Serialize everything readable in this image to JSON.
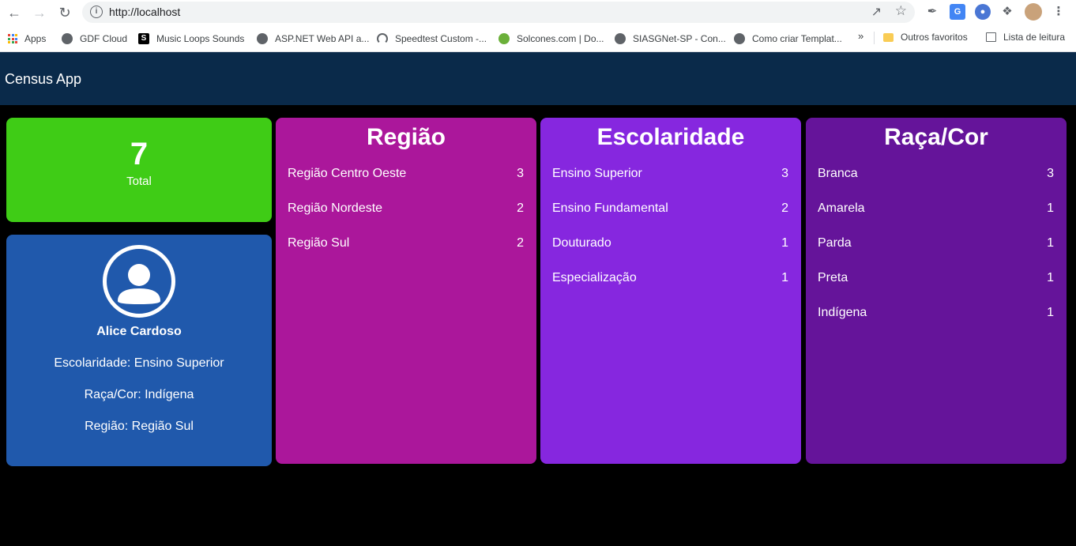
{
  "browser": {
    "url": "http://localhost",
    "bookmarks": [
      {
        "label": "Apps",
        "icon": "apps-grid-icon"
      },
      {
        "label": "GDF Cloud",
        "icon": "globe-icon"
      },
      {
        "label": "Music Loops Sounds",
        "icon": "s-logo-icon"
      },
      {
        "label": "ASP.NET Web API a...",
        "icon": "globe-icon"
      },
      {
        "label": "Speedtest Custom -...",
        "icon": "gauge-icon"
      },
      {
        "label": "Solcones.com | Do...",
        "icon": "solcones-icon"
      },
      {
        "label": "SIASGNet-SP - Con...",
        "icon": "globe-icon"
      },
      {
        "label": "Como criar Templat...",
        "icon": "globe-icon"
      }
    ],
    "more": "»",
    "other_favorites": "Outros favoritos",
    "reading_list": "Lista de leitura"
  },
  "app": {
    "title": "Census App"
  },
  "total": {
    "value": "7",
    "label": "Total"
  },
  "profile": {
    "name": "Alice Cardoso",
    "lines": [
      "Escolaridade: Ensino Superior",
      "Raça/Cor: Indígena",
      "Região: Região Sul"
    ]
  },
  "cards": [
    {
      "title": "Região",
      "color": "#ab179b",
      "rows": [
        {
          "label": "Região Centro Oeste",
          "count": "3"
        },
        {
          "label": "Região Nordeste",
          "count": "2"
        },
        {
          "label": "Região Sul",
          "count": "2"
        }
      ]
    },
    {
      "title": "Escolaridade",
      "color": "#8627df",
      "rows": [
        {
          "label": "Ensino Superior",
          "count": "3"
        },
        {
          "label": "Ensino Fundamental",
          "count": "2"
        },
        {
          "label": "Douturado",
          "count": "1"
        },
        {
          "label": "Especialização",
          "count": "1"
        }
      ]
    },
    {
      "title": "Raça/Cor",
      "color": "#65149a",
      "rows": [
        {
          "label": "Branca",
          "count": "3"
        },
        {
          "label": "Amarela",
          "count": "1"
        },
        {
          "label": "Parda",
          "count": "1"
        },
        {
          "label": "Preta",
          "count": "1"
        },
        {
          "label": "Indígena",
          "count": "1"
        }
      ]
    }
  ],
  "colors": {
    "header": "#0a2a4a",
    "total_card": "#3fcc16",
    "profile_card": "#2059ac"
  }
}
